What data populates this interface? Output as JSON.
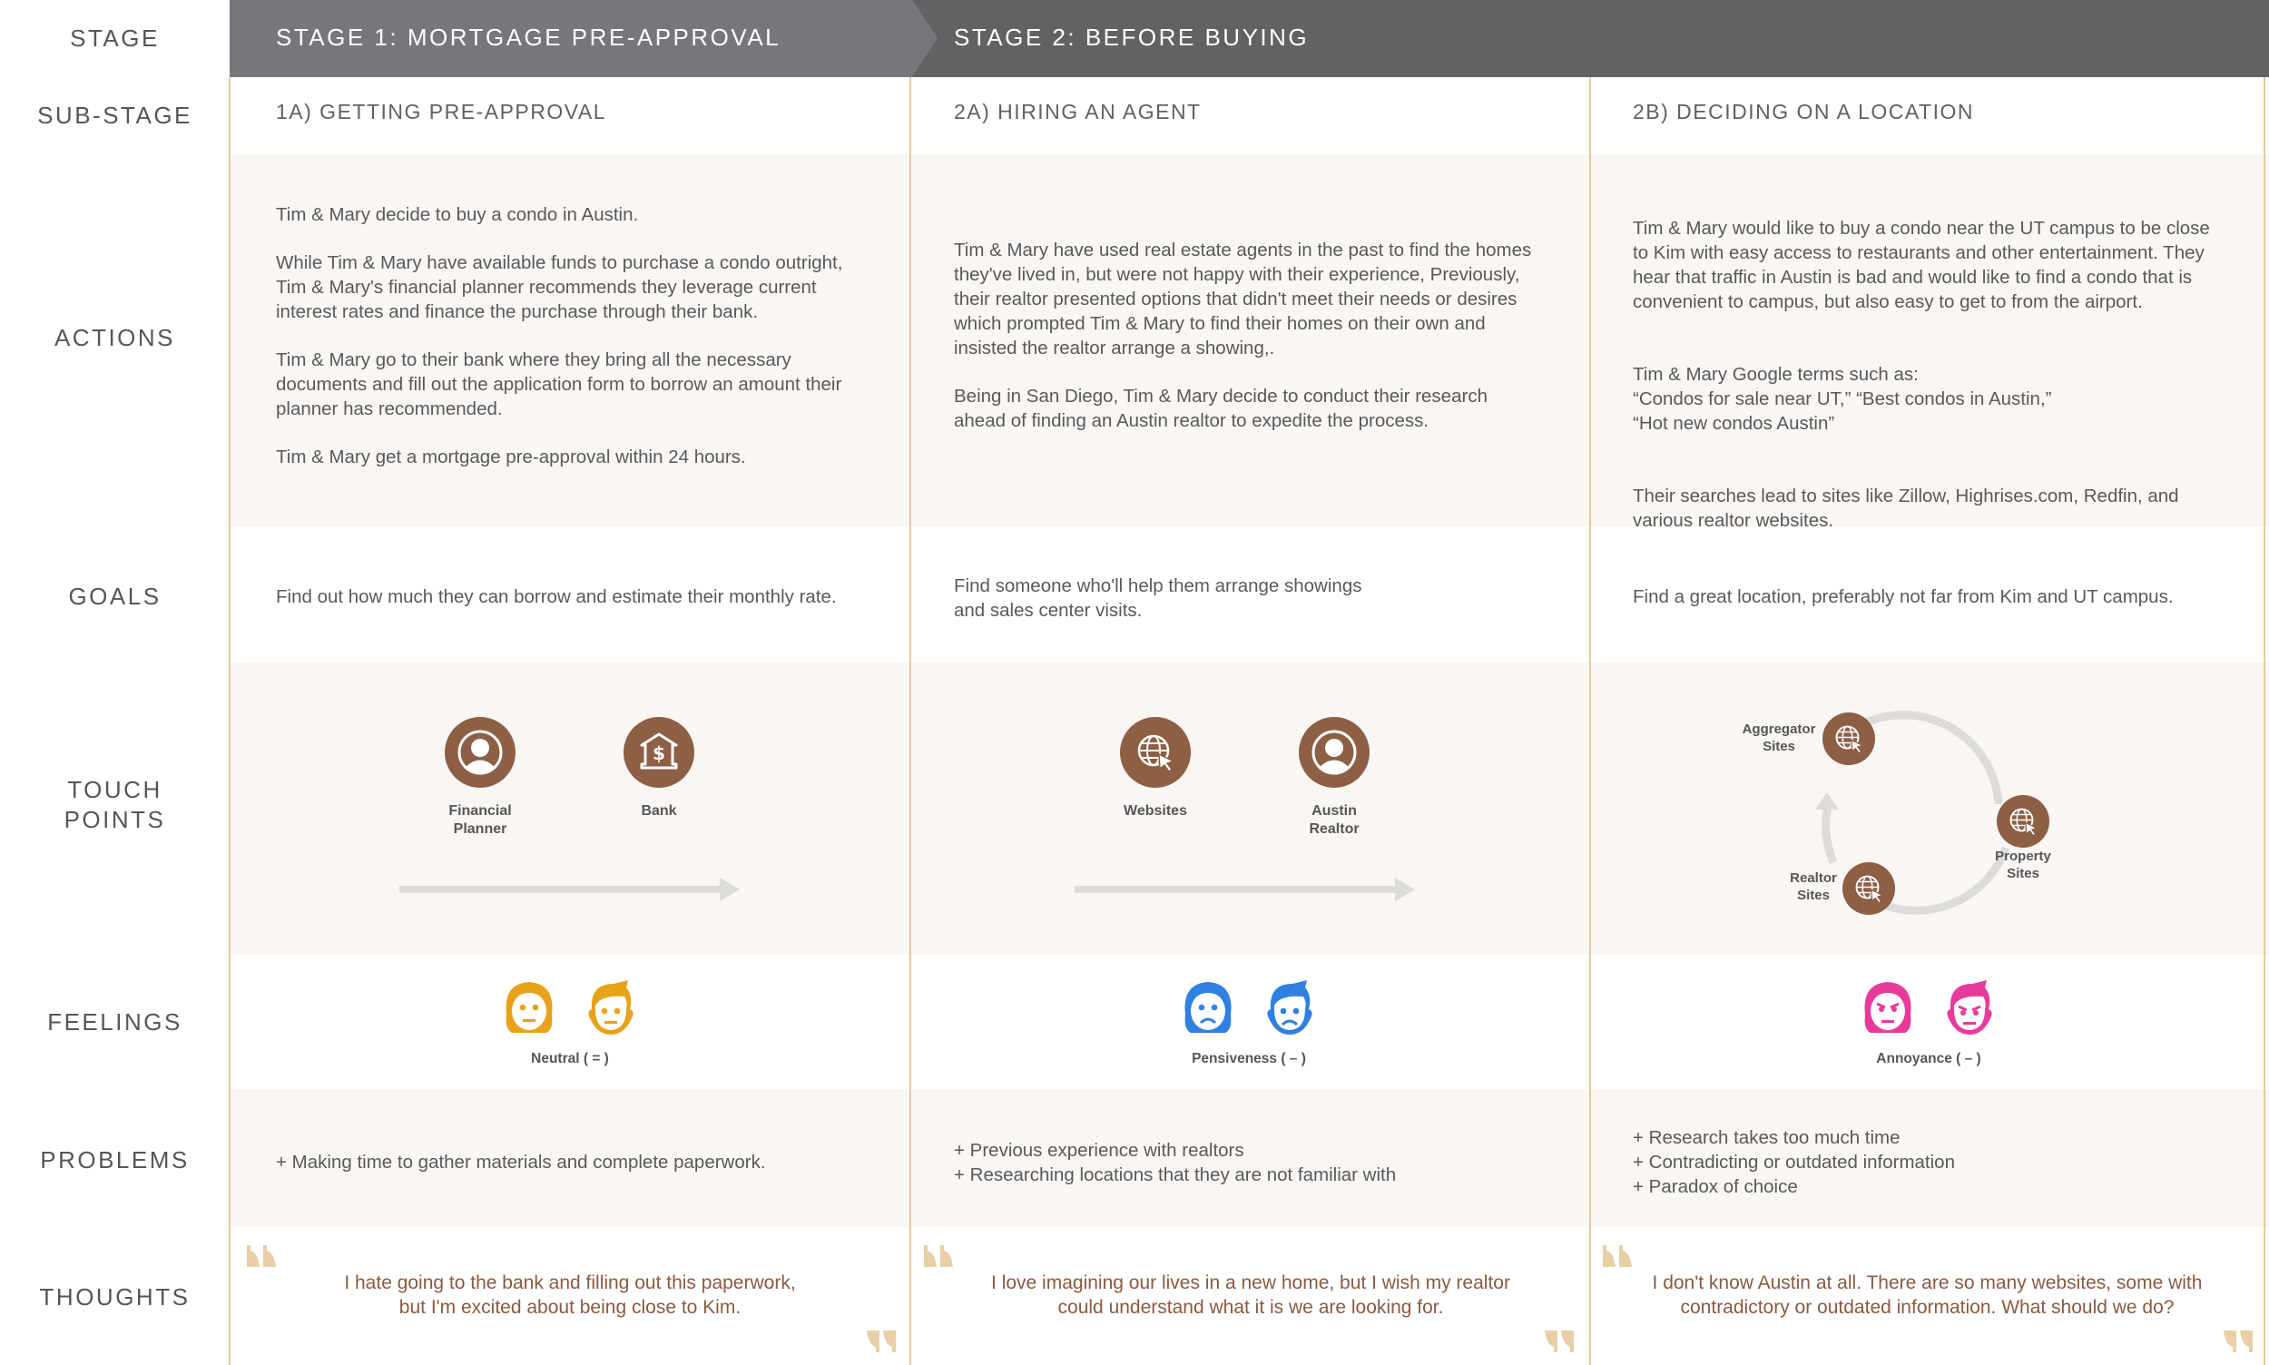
{
  "row_labels": {
    "stage": "STAGE",
    "substage": "SUB-STAGE",
    "actions": "ACTIONS",
    "goals": "GOALS",
    "touchpoints_line1": "TOUCH",
    "touchpoints_line2": "POINTS",
    "feelings": "FEELINGS",
    "problems": "PROBLEMS",
    "thoughts": "THOUGHTS"
  },
  "stages": [
    {
      "title": "STAGE 1: MORTGAGE PRE-APPROVAL",
      "color": "#76777b"
    },
    {
      "title": "STAGE 2: BEFORE BUYING",
      "color": "#616264"
    }
  ],
  "columns": [
    {
      "substage": "1A) GETTING PRE-APPROVAL",
      "actions": [
        "Tim & Mary decide to buy a condo in Austin.",
        "While Tim & Mary have available funds to purchase a condo outright, Tim & Mary's financial planner recommends they leverage current interest rates and finance the purchase through their bank.",
        "Tim & Mary go to their bank where they bring all the necessary documents and fill out the application form to borrow an amount their planner has recommended.",
        "Tim & Mary get a mortgage pre-approval within 24 hours."
      ],
      "goal": "Find out how much they can borrow and estimate their monthly rate.",
      "touchpoints": [
        {
          "label_line1": "Financial",
          "label_line2": "Planner",
          "icon": "person-icon"
        },
        {
          "label_line1": "Bank",
          "label_line2": "",
          "icon": "bank-icon"
        }
      ],
      "feeling": {
        "label": "Neutral ( = )",
        "mood": "neutral",
        "color": "#e8a21a"
      },
      "problems": [
        "+ Making time to gather materials and complete paperwork."
      ],
      "thought_line1": "I hate going to the bank and filling out this paperwork,",
      "thought_line2": "but I'm excited about being close to Kim."
    },
    {
      "substage": "2A) HIRING AN AGENT",
      "actions": [
        "Tim & Mary have used real estate agents in the past to find the homes they've lived in, but were not happy with their experience, Previously, their realtor presented options that didn't meet their needs or desires which prompted Tim & Mary to find their homes on their own and insisted the realtor arrange a showing,.",
        "Being in San Diego, Tim & Mary decide to conduct their research ahead of finding an Austin realtor to expedite the process."
      ],
      "goal_line1": "Find someone who'll help them arrange showings",
      "goal_line2": "and sales center visits.",
      "touchpoints": [
        {
          "label_line1": "Websites",
          "label_line2": "",
          "icon": "globe-cursor-icon"
        },
        {
          "label_line1": "Austin",
          "label_line2": "Realtor",
          "icon": "person-icon"
        }
      ],
      "feeling": {
        "label": "Pensiveness ( – )",
        "mood": "sad",
        "color": "#2f80e0"
      },
      "problems": [
        "+ Previous experience with realtors",
        "+ Researching locations that they are not familiar with"
      ],
      "thought_line1": "I love imagining our lives in a new home, but I wish my realtor",
      "thought_line2": "could understand what it is we are looking for."
    },
    {
      "substage": "2B) DECIDING ON A LOCATION",
      "actions": [
        "Tim & Mary would like to buy a condo near the UT campus to be close to Kim with easy access to restaurants and other entertainment. They hear that traffic in Austin is bad and would like to find a condo that is convenient to campus, but also easy to get to from the airport.",
        "Tim & Mary Google terms such as:\n“Condos for sale near UT,” “Best condos in Austin,”\n“Hot new condos Austin”",
        "Their searches lead to sites like Zillow, Highrises.com, Redfin, and various realtor websites."
      ],
      "goal": "Find a great location, preferably not far from Kim and UT campus.",
      "touchpoints": [
        {
          "label_line1": "Aggregator",
          "label_line2": "Sites",
          "icon": "globe-cursor-icon"
        },
        {
          "label_line1": "Property",
          "label_line2": "Sites",
          "icon": "globe-cursor-icon"
        },
        {
          "label_line1": "Realtor",
          "label_line2": "Sites",
          "icon": "globe-cursor-icon"
        }
      ],
      "feeling": {
        "label": "Annoyance ( – )",
        "mood": "angry",
        "color": "#e83a9c"
      },
      "problems": [
        "+ Research takes too much time",
        "+ Contradicting or outdated information",
        "+ Paradox of choice"
      ],
      "thought_line1": "I don't know Austin at all. There are so many websites, some with",
      "thought_line2": "contradictory or outdated information. What should we do?"
    }
  ],
  "colors": {
    "touchpoint": "#8d5f45",
    "divider": "#e6c99d",
    "quote_mark": "#e8cfa6",
    "thought_text": "#8a5a40",
    "row_beige": "#f9f6f3"
  }
}
